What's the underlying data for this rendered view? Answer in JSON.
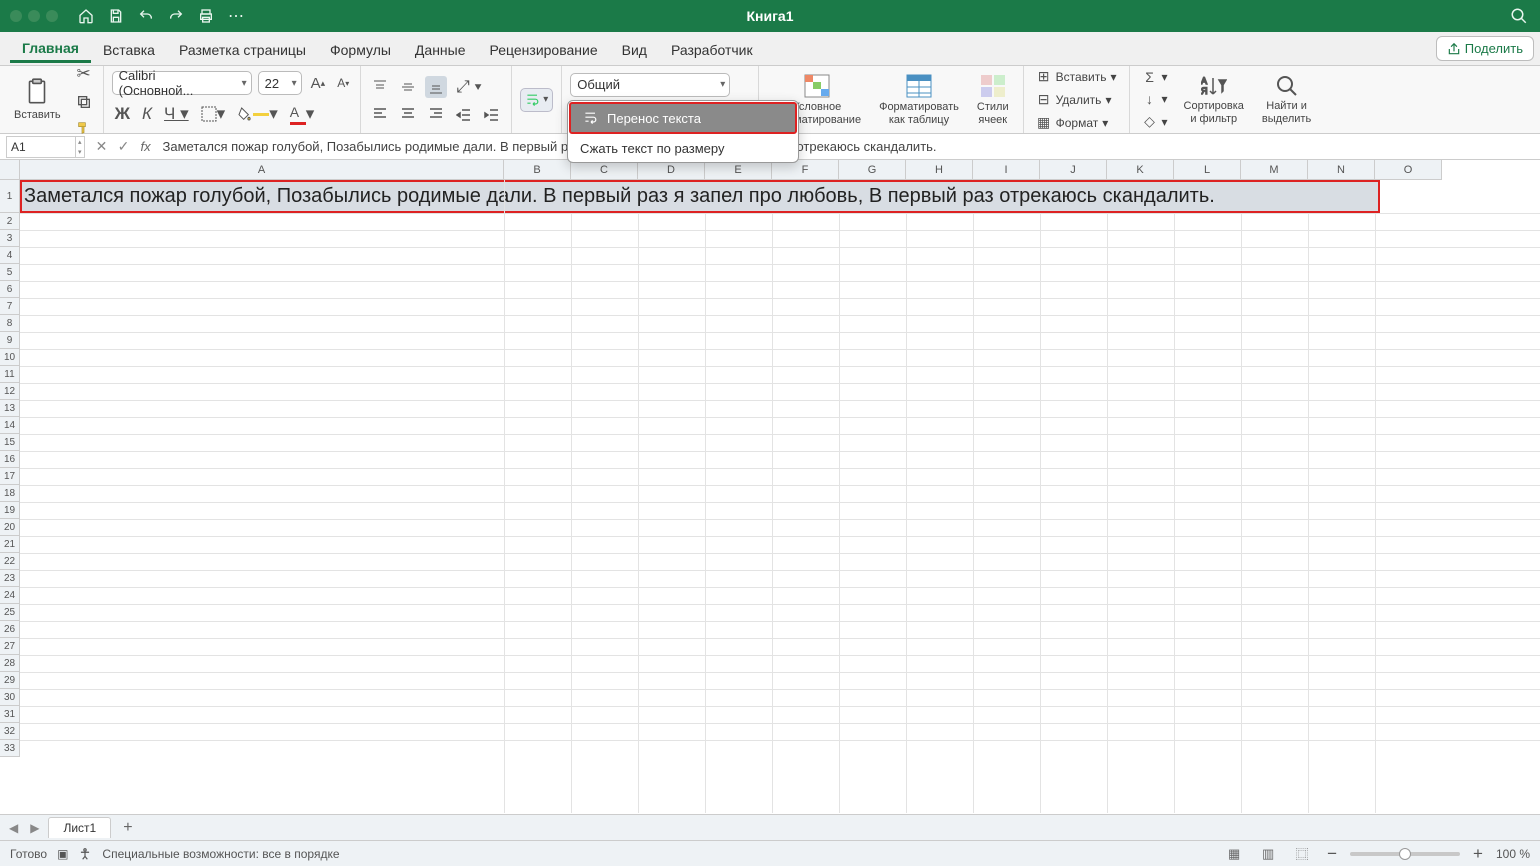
{
  "window": {
    "title": "Книга1"
  },
  "tabs": [
    "Главная",
    "Вставка",
    "Разметка страницы",
    "Формулы",
    "Данные",
    "Рецензирование",
    "Вид",
    "Разработчик"
  ],
  "share_label": "Поделить",
  "font": {
    "name": "Calibri (Основной...",
    "size": "22"
  },
  "paste_label": "Вставить",
  "number_format": "Общий",
  "wrap_menu": {
    "wrap": "Перенос текста",
    "shrink": "Сжать текст по размеру"
  },
  "bigbtns": {
    "cond_fmt": "Условное\nформатирование",
    "fmt_table": "Форматировать\nкак таблицу",
    "cell_styles": "Стили\nячеек",
    "sort_filter": "Сортировка\nи фильтр",
    "find_select": "Найти и\nвыделить"
  },
  "cells_group": {
    "insert": "Вставить",
    "delete": "Удалить",
    "format": "Формат"
  },
  "name_box": "A1",
  "formula": "Заметался пожар голубой, Позабылись родимые дали. В первый раз я запел про любовь, В первый раз отрекаюсь скандалить.",
  "cell_text": "Заметался пожар голубой, Позабылись родимые дали. В первый раз я запел про любовь, В первый раз отрекаюсь скандалить.",
  "columns": [
    "A",
    "B",
    "C",
    "D",
    "E",
    "F",
    "G",
    "H",
    "I",
    "J",
    "K",
    "L",
    "M",
    "N",
    "O"
  ],
  "rows": [
    1,
    2,
    3,
    4,
    5,
    6,
    7,
    8,
    9,
    10,
    11,
    12,
    13,
    14,
    15,
    16,
    17,
    18,
    19,
    20,
    21,
    22,
    23,
    24,
    25,
    26,
    27,
    28,
    29,
    30,
    31,
    32,
    33
  ],
  "sheet": {
    "name": "Лист1"
  },
  "status": {
    "ready": "Готово",
    "accessibility": "Специальные возможности: все в порядке",
    "zoom": "100 %"
  }
}
